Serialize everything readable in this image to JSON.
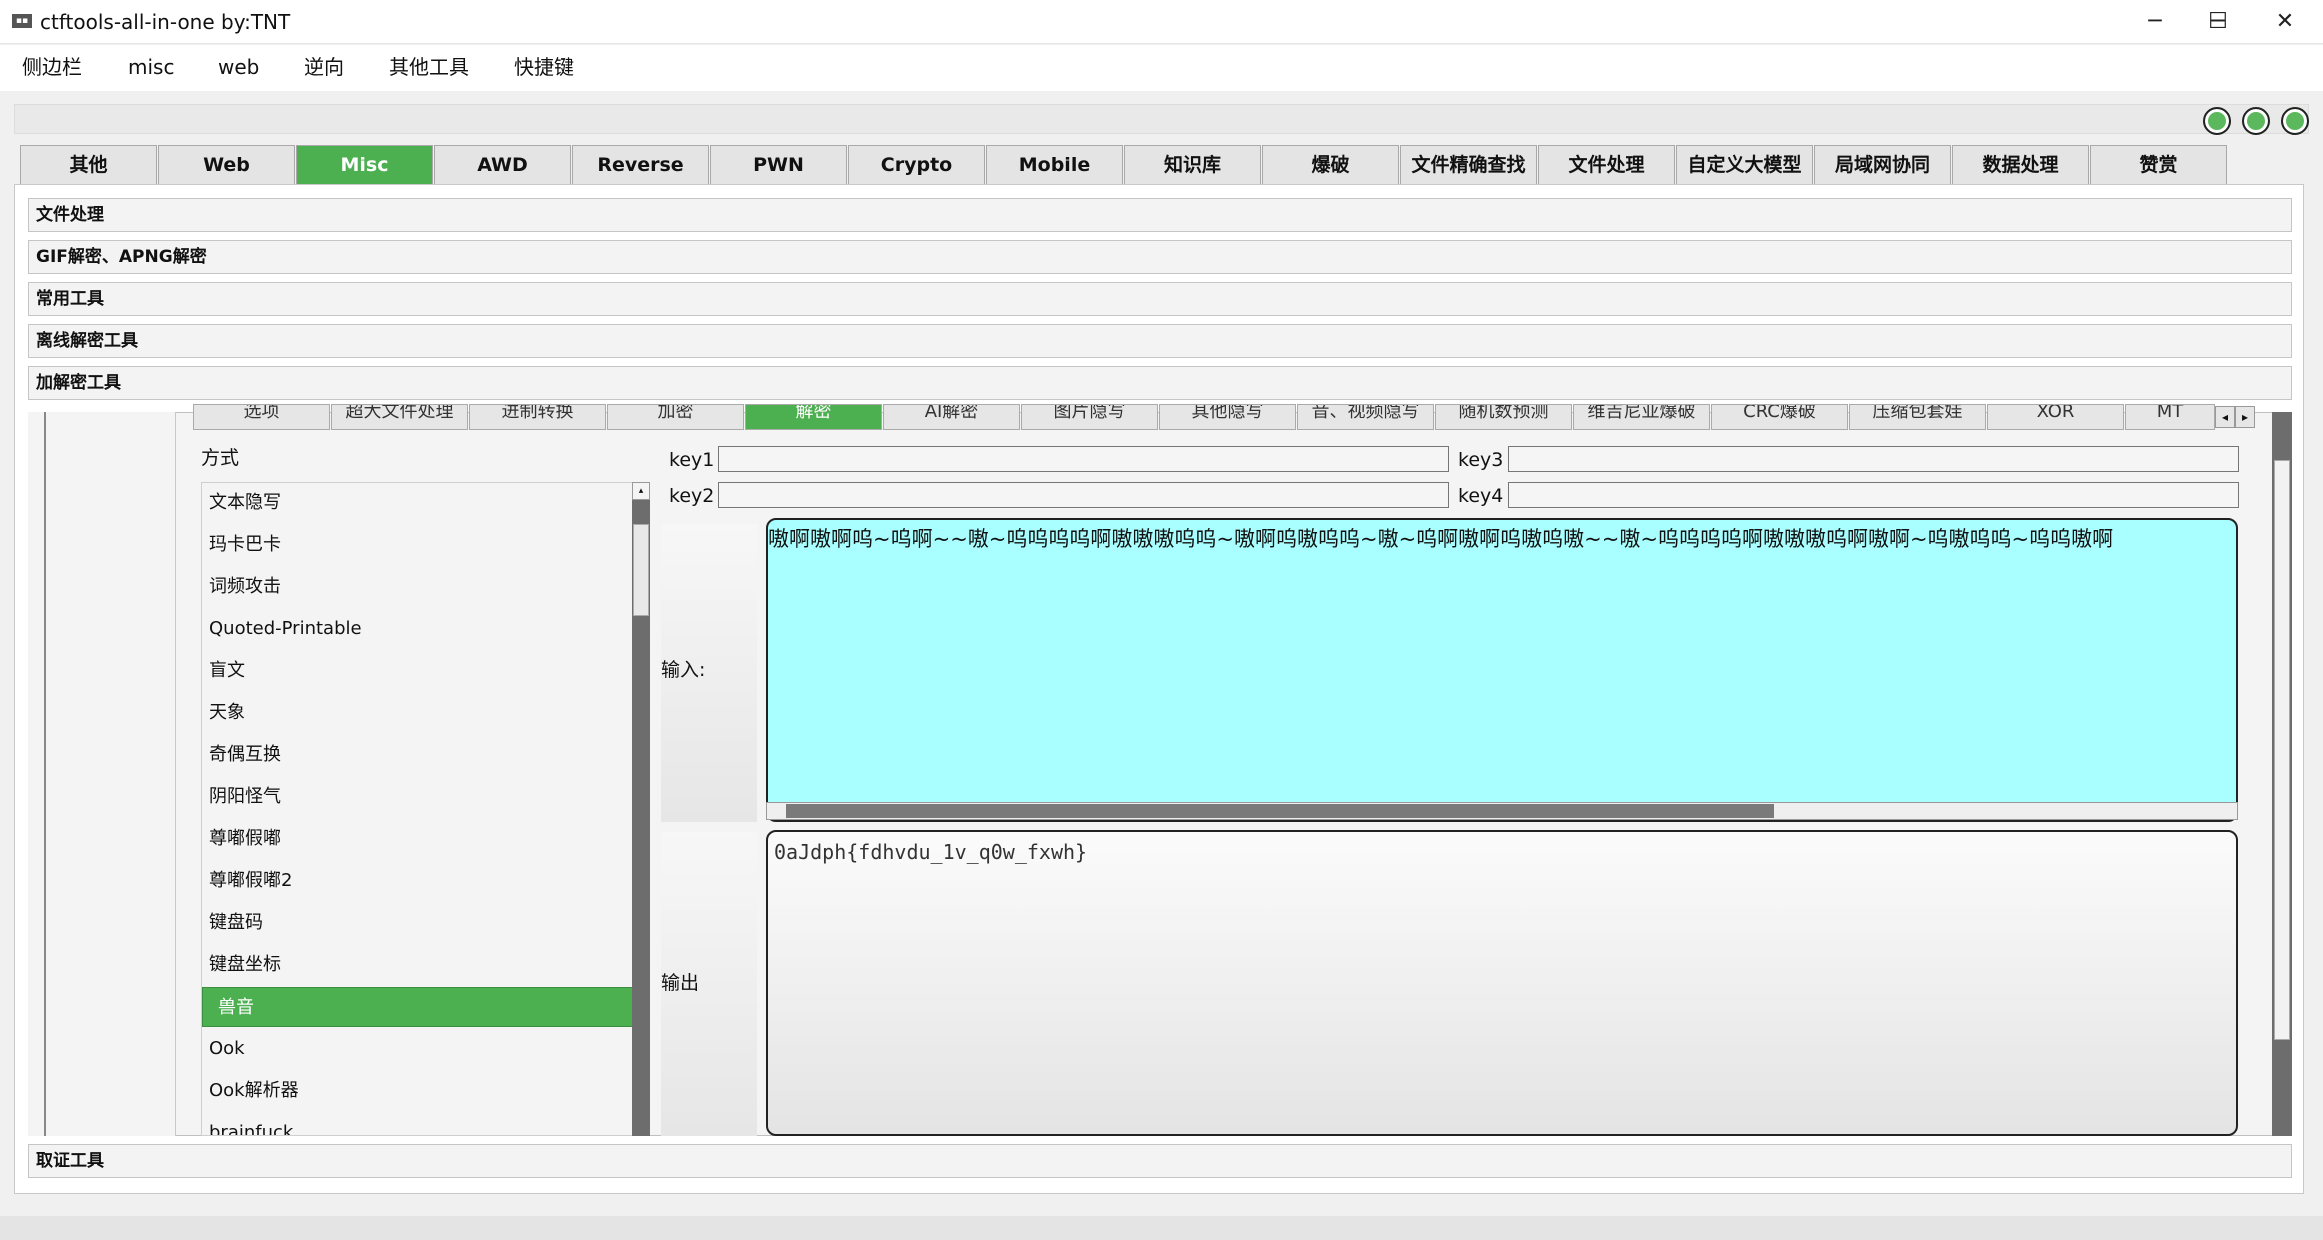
{
  "window": {
    "title": "ctftools-all-in-one   by:TNT",
    "minimize": "─",
    "maximize": "☐",
    "close": "✕"
  },
  "menu": [
    "侧边栏",
    "misc",
    "web",
    "逆向",
    "其他工具",
    "快捷键"
  ],
  "tabs": [
    "其他",
    "Web",
    "Misc",
    "AWD",
    "Reverse",
    "PWN",
    "Crypto",
    "Mobile",
    "知识库",
    "爆破",
    "文件精确查找",
    "文件处理",
    "自定义大模型",
    "局域网协同",
    "数据处理",
    "赞赏"
  ],
  "active_tab": "Misc",
  "sections": [
    "文件处理",
    "GIF解密、APNG解密",
    "常用工具",
    "离线解密工具",
    "加解密工具"
  ],
  "footer_section": "取证工具",
  "sub_tabs": [
    "选项",
    "超大文件处理",
    "进制转换",
    "加密",
    "解密",
    "AI解密",
    "图片隐写",
    "其他隐写",
    "音、视频隐写",
    "随机数预测",
    "维吉尼亚爆破",
    "CRC爆破",
    "压缩包套娃",
    "XOR",
    "MT"
  ],
  "active_sub_tab": "解密",
  "method_label": "方式",
  "methods": [
    "文本隐写",
    "玛卡巴卡",
    "词频攻击",
    "Quoted-Printable",
    "盲文",
    "天象",
    "奇偶互换",
    "阴阳怪气",
    "尊嘟假嘟",
    "尊嘟假嘟2",
    "键盘码",
    "键盘坐标",
    "兽音",
    "Ook",
    "Ook解析器",
    "brainfuck"
  ],
  "selected_method": "兽音",
  "keys": {
    "key1_label": "key1",
    "key2_label": "key2",
    "key3_label": "key3",
    "key4_label": "key4",
    "key1": "",
    "key2": "",
    "key3": "",
    "key4": ""
  },
  "input_label": "输入:",
  "input_value": "嗷啊嗷啊呜~呜啊~~嗷~呜呜呜呜啊嗷嗷嗷呜呜~嗷啊呜嗷呜呜~嗷~呜啊嗷啊呜嗷呜嗷~~嗷~呜呜呜呜啊嗷嗷嗷呜啊嗷啊~呜嗷呜呜~呜呜嗷啊",
  "output_label": "输出",
  "output_value": "0aJdph{fdhvdu_1v_q0w_fxwh}",
  "colors": {
    "accent": "#4caf50",
    "input_bg": "#a9ffff"
  }
}
